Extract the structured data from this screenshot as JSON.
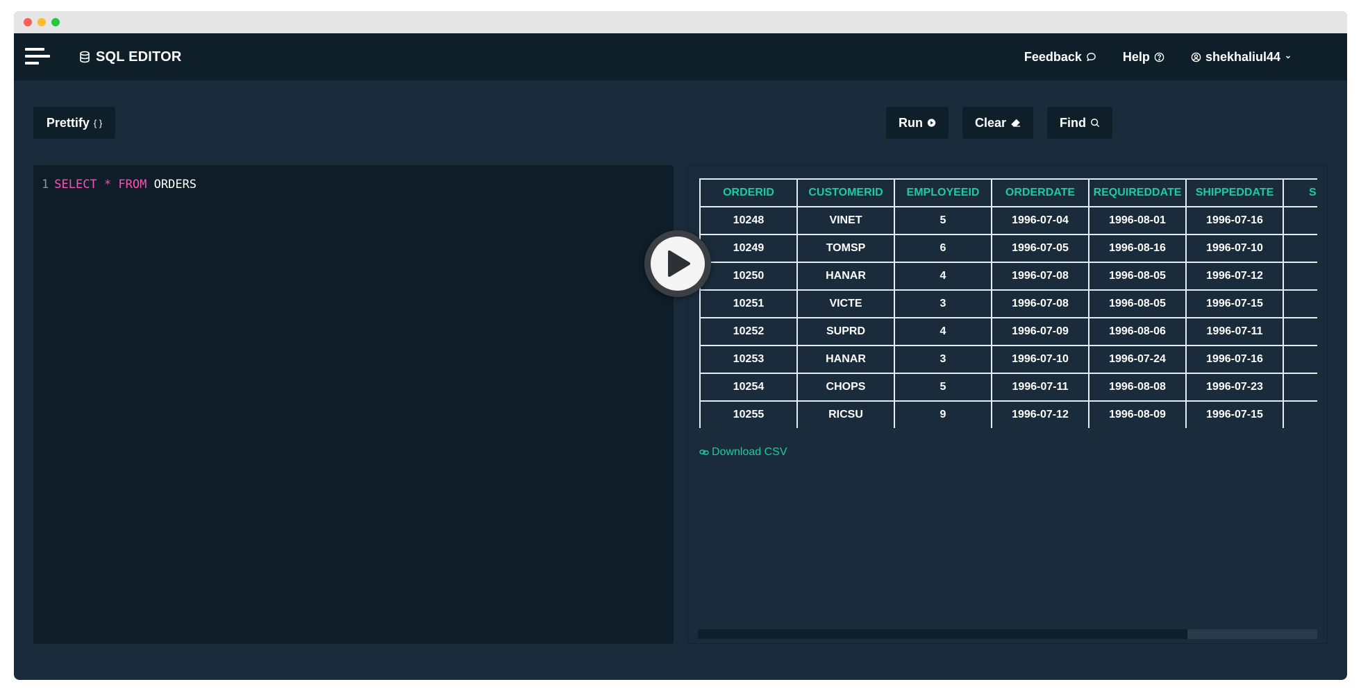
{
  "app": {
    "title": "SQL EDITOR"
  },
  "nav": {
    "feedback": "Feedback",
    "help": "Help",
    "user": "shekhaliul44"
  },
  "toolbar": {
    "prettify": "Prettify",
    "prettify_glyph": "{ }",
    "run": "Run",
    "clear": "Clear",
    "find": "Find"
  },
  "editor": {
    "line_number": "1",
    "kw_select": "SELECT",
    "star": "*",
    "kw_from": "FROM",
    "table": "ORDERS"
  },
  "results": {
    "columns": [
      "ORDERID",
      "CUSTOMERID",
      "EMPLOYEEID",
      "ORDERDATE",
      "REQUIREDDATE",
      "SHIPPEDDATE",
      "S"
    ],
    "rows": [
      [
        "10248",
        "VINET",
        "5",
        "1996-07-04",
        "1996-08-01",
        "1996-07-16",
        ""
      ],
      [
        "10249",
        "TOMSP",
        "6",
        "1996-07-05",
        "1996-08-16",
        "1996-07-10",
        ""
      ],
      [
        "10250",
        "HANAR",
        "4",
        "1996-07-08",
        "1996-08-05",
        "1996-07-12",
        ""
      ],
      [
        "10251",
        "VICTE",
        "3",
        "1996-07-08",
        "1996-08-05",
        "1996-07-15",
        ""
      ],
      [
        "10252",
        "SUPRD",
        "4",
        "1996-07-09",
        "1996-08-06",
        "1996-07-11",
        ""
      ],
      [
        "10253",
        "HANAR",
        "3",
        "1996-07-10",
        "1996-07-24",
        "1996-07-16",
        ""
      ],
      [
        "10254",
        "CHOPS",
        "5",
        "1996-07-11",
        "1996-08-08",
        "1996-07-23",
        ""
      ],
      [
        "10255",
        "RICSU",
        "9",
        "1996-07-12",
        "1996-08-09",
        "1996-07-15",
        ""
      ]
    ],
    "download_label": "Download CSV"
  },
  "colors": {
    "accent": "#1fc9a4",
    "keyword": "#ff4fb6",
    "bg": "#1a2b3b",
    "panel": "#0f1f2a"
  },
  "icons": {
    "menu": "hamburger-icon",
    "brand": "database-icon",
    "feedback": "speech-bubble-icon",
    "help": "question-circle-icon",
    "user": "user-circle-icon",
    "caret": "chevron-down-icon",
    "run": "play-circle-icon",
    "clear": "eraser-icon",
    "find": "search-icon",
    "download": "link-icon",
    "overlay": "play-button-icon"
  }
}
